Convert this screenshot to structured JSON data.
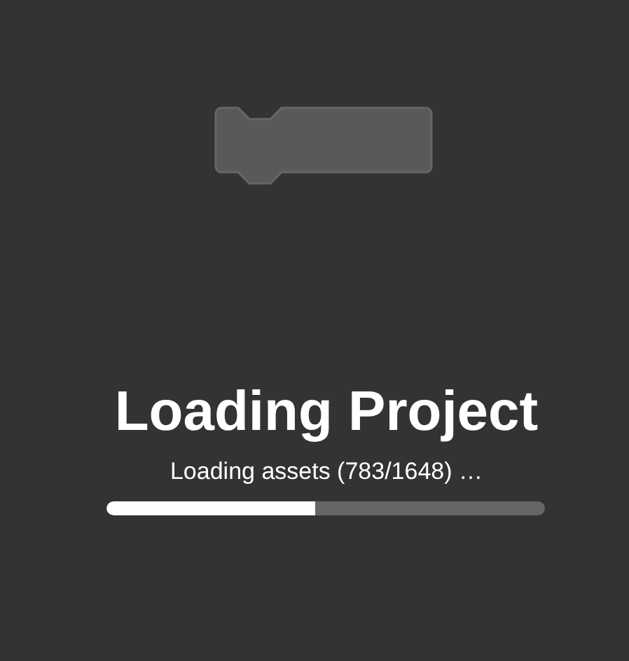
{
  "title": "Loading Project",
  "status": "Loading assets (783/1648) …",
  "progress": {
    "level": 0.475
  }
}
